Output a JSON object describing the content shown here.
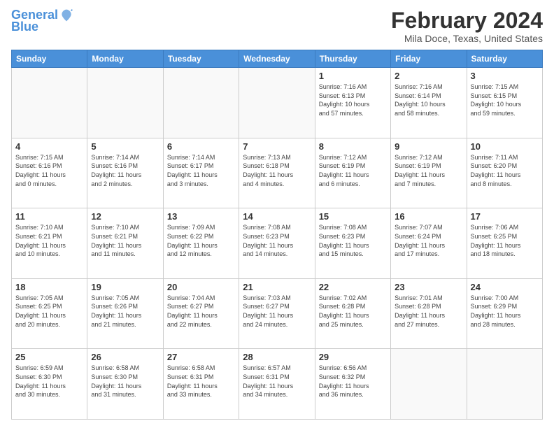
{
  "header": {
    "logo_line1": "General",
    "logo_line2": "Blue",
    "title": "February 2024",
    "subtitle": "Mila Doce, Texas, United States"
  },
  "weekdays": [
    "Sunday",
    "Monday",
    "Tuesday",
    "Wednesday",
    "Thursday",
    "Friday",
    "Saturday"
  ],
  "weeks": [
    [
      {
        "day": "",
        "info": ""
      },
      {
        "day": "",
        "info": ""
      },
      {
        "day": "",
        "info": ""
      },
      {
        "day": "",
        "info": ""
      },
      {
        "day": "1",
        "info": "Sunrise: 7:16 AM\nSunset: 6:13 PM\nDaylight: 10 hours\nand 57 minutes."
      },
      {
        "day": "2",
        "info": "Sunrise: 7:16 AM\nSunset: 6:14 PM\nDaylight: 10 hours\nand 58 minutes."
      },
      {
        "day": "3",
        "info": "Sunrise: 7:15 AM\nSunset: 6:15 PM\nDaylight: 10 hours\nand 59 minutes."
      }
    ],
    [
      {
        "day": "4",
        "info": "Sunrise: 7:15 AM\nSunset: 6:16 PM\nDaylight: 11 hours\nand 0 minutes."
      },
      {
        "day": "5",
        "info": "Sunrise: 7:14 AM\nSunset: 6:16 PM\nDaylight: 11 hours\nand 2 minutes."
      },
      {
        "day": "6",
        "info": "Sunrise: 7:14 AM\nSunset: 6:17 PM\nDaylight: 11 hours\nand 3 minutes."
      },
      {
        "day": "7",
        "info": "Sunrise: 7:13 AM\nSunset: 6:18 PM\nDaylight: 11 hours\nand 4 minutes."
      },
      {
        "day": "8",
        "info": "Sunrise: 7:12 AM\nSunset: 6:19 PM\nDaylight: 11 hours\nand 6 minutes."
      },
      {
        "day": "9",
        "info": "Sunrise: 7:12 AM\nSunset: 6:19 PM\nDaylight: 11 hours\nand 7 minutes."
      },
      {
        "day": "10",
        "info": "Sunrise: 7:11 AM\nSunset: 6:20 PM\nDaylight: 11 hours\nand 8 minutes."
      }
    ],
    [
      {
        "day": "11",
        "info": "Sunrise: 7:10 AM\nSunset: 6:21 PM\nDaylight: 11 hours\nand 10 minutes."
      },
      {
        "day": "12",
        "info": "Sunrise: 7:10 AM\nSunset: 6:21 PM\nDaylight: 11 hours\nand 11 minutes."
      },
      {
        "day": "13",
        "info": "Sunrise: 7:09 AM\nSunset: 6:22 PM\nDaylight: 11 hours\nand 12 minutes."
      },
      {
        "day": "14",
        "info": "Sunrise: 7:08 AM\nSunset: 6:23 PM\nDaylight: 11 hours\nand 14 minutes."
      },
      {
        "day": "15",
        "info": "Sunrise: 7:08 AM\nSunset: 6:23 PM\nDaylight: 11 hours\nand 15 minutes."
      },
      {
        "day": "16",
        "info": "Sunrise: 7:07 AM\nSunset: 6:24 PM\nDaylight: 11 hours\nand 17 minutes."
      },
      {
        "day": "17",
        "info": "Sunrise: 7:06 AM\nSunset: 6:25 PM\nDaylight: 11 hours\nand 18 minutes."
      }
    ],
    [
      {
        "day": "18",
        "info": "Sunrise: 7:05 AM\nSunset: 6:25 PM\nDaylight: 11 hours\nand 20 minutes."
      },
      {
        "day": "19",
        "info": "Sunrise: 7:05 AM\nSunset: 6:26 PM\nDaylight: 11 hours\nand 21 minutes."
      },
      {
        "day": "20",
        "info": "Sunrise: 7:04 AM\nSunset: 6:27 PM\nDaylight: 11 hours\nand 22 minutes."
      },
      {
        "day": "21",
        "info": "Sunrise: 7:03 AM\nSunset: 6:27 PM\nDaylight: 11 hours\nand 24 minutes."
      },
      {
        "day": "22",
        "info": "Sunrise: 7:02 AM\nSunset: 6:28 PM\nDaylight: 11 hours\nand 25 minutes."
      },
      {
        "day": "23",
        "info": "Sunrise: 7:01 AM\nSunset: 6:28 PM\nDaylight: 11 hours\nand 27 minutes."
      },
      {
        "day": "24",
        "info": "Sunrise: 7:00 AM\nSunset: 6:29 PM\nDaylight: 11 hours\nand 28 minutes."
      }
    ],
    [
      {
        "day": "25",
        "info": "Sunrise: 6:59 AM\nSunset: 6:30 PM\nDaylight: 11 hours\nand 30 minutes."
      },
      {
        "day": "26",
        "info": "Sunrise: 6:58 AM\nSunset: 6:30 PM\nDaylight: 11 hours\nand 31 minutes."
      },
      {
        "day": "27",
        "info": "Sunrise: 6:58 AM\nSunset: 6:31 PM\nDaylight: 11 hours\nand 33 minutes."
      },
      {
        "day": "28",
        "info": "Sunrise: 6:57 AM\nSunset: 6:31 PM\nDaylight: 11 hours\nand 34 minutes."
      },
      {
        "day": "29",
        "info": "Sunrise: 6:56 AM\nSunset: 6:32 PM\nDaylight: 11 hours\nand 36 minutes."
      },
      {
        "day": "",
        "info": ""
      },
      {
        "day": "",
        "info": ""
      }
    ]
  ]
}
